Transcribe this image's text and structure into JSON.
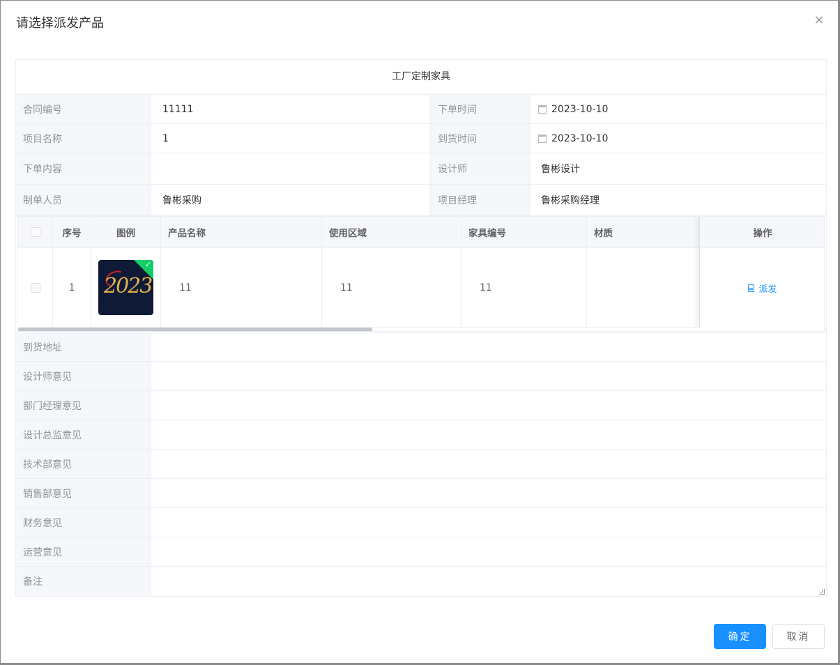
{
  "dialog": {
    "title": "请选择派发产品",
    "close_glyph": "×"
  },
  "form": {
    "header": "工厂定制家具",
    "rows": [
      {
        "label1": "合同编号",
        "value1": "11111",
        "label2": "下单时间",
        "value2": "2023-10-10"
      },
      {
        "label1": "项目名称",
        "value1": "1",
        "label2": "到货时间",
        "value2": "2023-10-10"
      },
      {
        "label1": "下单内容",
        "value1": "",
        "label2": "设计师",
        "value2": "鲁彬设计"
      },
      {
        "label1": "制单人员",
        "value1": "鲁彬采购",
        "label2": "项目经理",
        "value2": "鲁彬采购经理"
      }
    ],
    "opinions": [
      {
        "label": "到货地址",
        "value": ""
      },
      {
        "label": "设计师意见",
        "value": ""
      },
      {
        "label": "部门经理意见",
        "value": ""
      },
      {
        "label": "设计总监意见",
        "value": ""
      },
      {
        "label": "技术部意见",
        "value": ""
      },
      {
        "label": "销售部意见",
        "value": ""
      },
      {
        "label": "财务意见",
        "value": ""
      },
      {
        "label": "运营意见",
        "value": ""
      },
      {
        "label": "备注",
        "value": ""
      }
    ]
  },
  "table": {
    "columns": [
      "序号",
      "图例",
      "产品名称",
      "使用区域",
      "家具编号",
      "材质",
      "操作"
    ],
    "rows": [
      {
        "index": "1",
        "image_text": "2023",
        "product_name": "11",
        "area": "11",
        "furniture_no": "11",
        "material": "",
        "action": "派发"
      }
    ]
  },
  "footer": {
    "confirm": "确定",
    "cancel": "取消"
  },
  "colors": {
    "primary": "#1890ff",
    "success": "#13ce66",
    "border": "#ebeef5",
    "label_bg": "#f5f7fa"
  }
}
